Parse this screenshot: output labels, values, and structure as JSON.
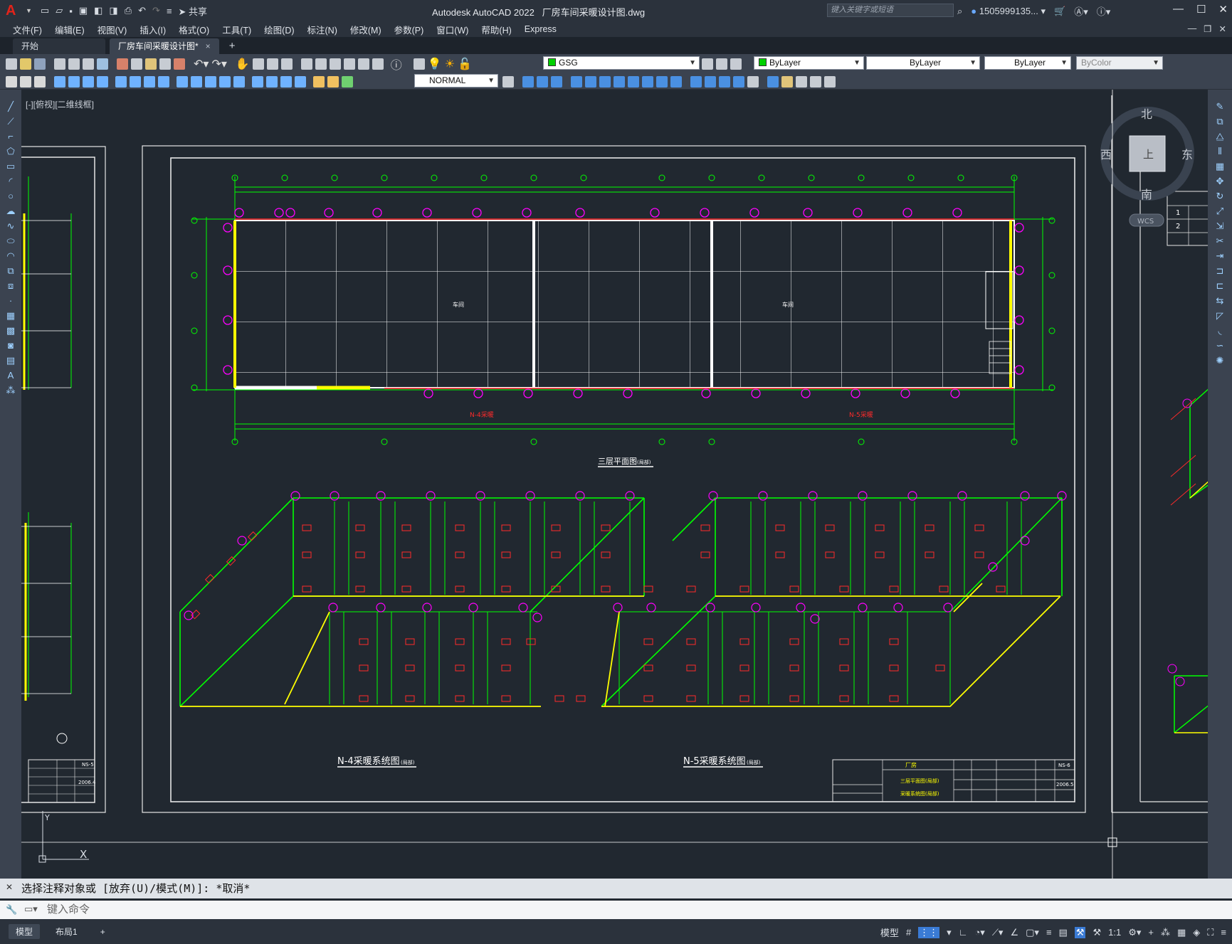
{
  "app": {
    "title": "Autodesk AutoCAD 2022",
    "document": "厂房车间采暖设计图.dwg",
    "logo": "A"
  },
  "qat": {
    "share": "共享"
  },
  "search": {
    "placeholder": "键入关键字或短语"
  },
  "user": {
    "name": "1505999135..."
  },
  "menu": [
    "文件(F)",
    "编辑(E)",
    "视图(V)",
    "插入(I)",
    "格式(O)",
    "工具(T)",
    "绘图(D)",
    "标注(N)",
    "修改(M)",
    "参数(P)",
    "窗口(W)",
    "帮助(H)",
    "Express"
  ],
  "tabs": {
    "start": "开始",
    "active": "厂房车间采暖设计图*",
    "close": "×",
    "new": "+"
  },
  "ribbon": {
    "layer": "GSG",
    "color": "ByLayer",
    "linetype": "ByLayer",
    "lineweight": "ByLayer",
    "plotstyle": "ByColor",
    "dimstyle": "NORMAL"
  },
  "view": {
    "label": "[-][俯视][二维线框]"
  },
  "viewcube": {
    "north": "北",
    "south": "南",
    "east": "东",
    "west": "西",
    "top": "上",
    "wcs": "WCS"
  },
  "drawing": {
    "plan_title": "三层平面图",
    "plan_scale": "(局部)",
    "room_a": "车间",
    "room_b": "车间",
    "n4_plan": "N-4采暖",
    "n5_plan": "N-5采暖",
    "sys4_title": "N-4采暖系统图",
    "sys4_scale": "(局部)",
    "sys5_title": "N-5采暖系统图",
    "sys5_scale": "(局部)",
    "titleblock_company": "厂房",
    "titleblock_line1": "三层平面图(局部)",
    "titleblock_line2": "采暖系统图(局部)",
    "titleblock_no": "NS-6",
    "titleblock_date": "2006.5",
    "left_no": "NS-5",
    "left_date": "2006.4",
    "right_row1": "1",
    "right_row2": "2",
    "ucs_y": "Y",
    "ucs_x": "X"
  },
  "command": {
    "history": "选择注释对象或 [放弃(U)/模式(M)]: *取消*",
    "placeholder": "键入命令"
  },
  "status": {
    "model_tab": "模型",
    "layout_tab": "布局1",
    "add": "+",
    "space": "模型",
    "scale": "1:1"
  }
}
